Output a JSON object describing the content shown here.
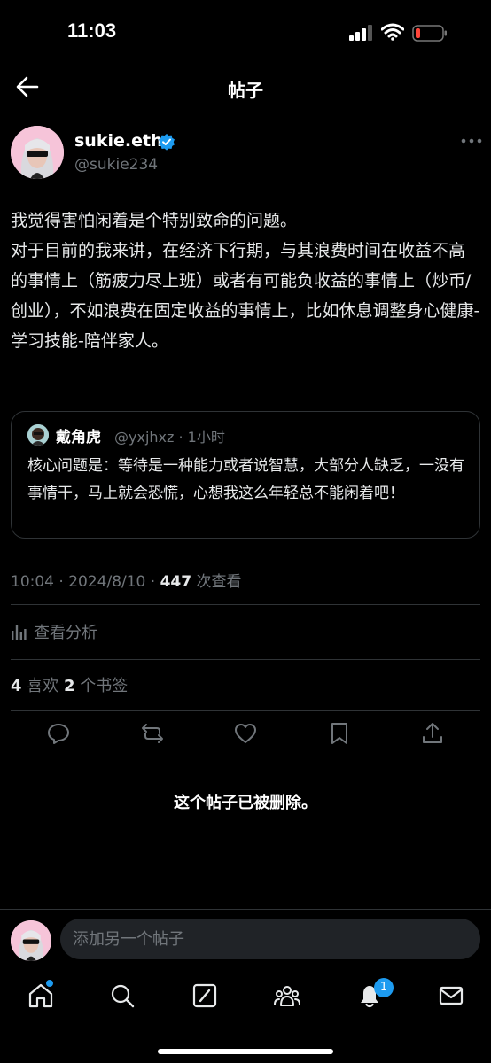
{
  "status_bar": {
    "time": "11:03"
  },
  "header": {
    "title": "帖子"
  },
  "post": {
    "author_name": "sukie.eth",
    "author_handle": "@sukie234",
    "text": "我觉得害怕闲着是个特别致命的问题。\n对于目前的我来讲，在经济下行期，与其浪费时间在收益不高的事情上（筋疲力尽上班）或者有可能负收益的事情上（炒币/创业），不如浪费在固定收益的事情上，比如休息调整身心健康-学习技能-陪伴家人。",
    "quote": {
      "name": "戴角虎",
      "meta": "@yxjhxz · 1小时",
      "text": "核心问题是：等待是一种能力或者说智慧，大部分人缺乏，一没有事情干，马上就会恐慌，心想我这么年轻总不能闲着吧！"
    },
    "timestamp": "10:04 · 2024/8/10 · ",
    "views_count": "447",
    "views_label": " 次查看",
    "analytics_label": "查看分析",
    "likes_count": "4",
    "likes_label": " 喜欢  ",
    "bookmarks_count": "2",
    "bookmarks_label": " 个书签"
  },
  "deleted_notice": "这个帖子已被删除。",
  "reply": {
    "placeholder": "添加另一个帖子"
  },
  "tabbar": {
    "notification_badge": "1"
  },
  "colors": {
    "accent": "#1d9bf0",
    "muted": "#71767b",
    "border": "#2f3336"
  }
}
